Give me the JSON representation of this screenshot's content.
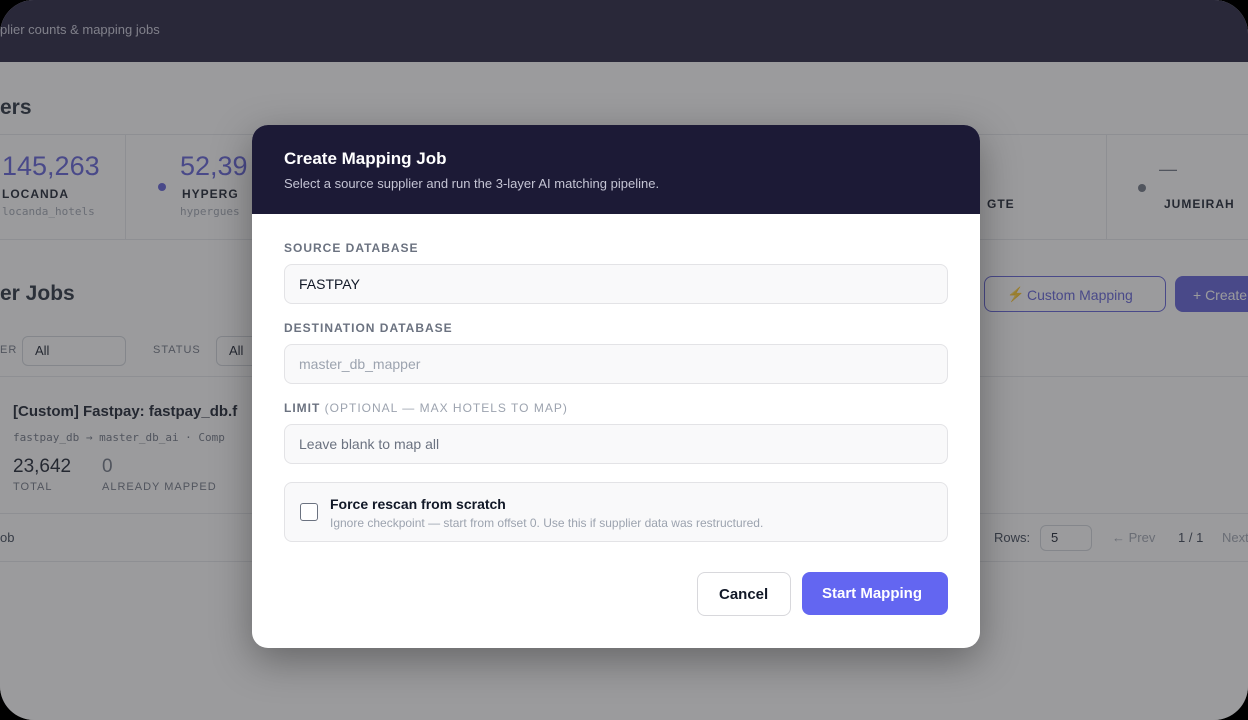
{
  "background": {
    "topbar_subtitle": "plier counts & mapping jobs",
    "section_title": "ers",
    "suppliers": [
      {
        "count": "145,263",
        "name": "LOCANDA",
        "db": "locanda_hotels"
      },
      {
        "count": "52,39",
        "name": "HYPERG",
        "db": "hypergues"
      },
      {
        "count": "",
        "name": "GTE",
        "db": ""
      },
      {
        "count": "—",
        "name": "JUMEIRAH",
        "db": ""
      }
    ],
    "jobs_title": "er Jobs",
    "custom_mapping_label": "Custom Mapping",
    "create_label": "+ Create",
    "filters": {
      "supplier_label": "ER",
      "supplier_value": "All",
      "status_label": "STATUS",
      "status_value": "All"
    },
    "job": {
      "title": "[Custom] Fastpay: fastpay_db.f",
      "path": "fastpay_db → master_db_ai · Comp",
      "total": "23,642",
      "total_label": "TOTAL",
      "already_mapped": "0",
      "already_mapped_label": "ALREADY MAPPED"
    },
    "footer": {
      "left": "ob",
      "rows_label": "Rows:",
      "rows_value": "5",
      "prev": "← Prev",
      "page": "1 / 1",
      "next": "Next"
    }
  },
  "modal": {
    "title": "Create Mapping Job",
    "subtitle": "Select a source supplier and run the 3-layer AI matching pipeline.",
    "source_label": "SOURCE DATABASE",
    "source_value": "FASTPAY",
    "destination_label": "DESTINATION DATABASE",
    "destination_value": "master_db_mapper",
    "limit_label": "LIMIT",
    "limit_hint": "(OPTIONAL — MAX HOTELS TO MAP)",
    "limit_placeholder": "Leave blank to map all",
    "rescan_title": "Force rescan from scratch",
    "rescan_desc": "Ignore checkpoint — start from offset 0. Use this if supplier data was restructured.",
    "rescan_checked": false,
    "cancel_label": "Cancel",
    "start_label": "Start Mapping"
  },
  "colors": {
    "accent": "#5b5bd6",
    "primary_button": "#6366f1",
    "header_dark": "#1c1a36"
  }
}
